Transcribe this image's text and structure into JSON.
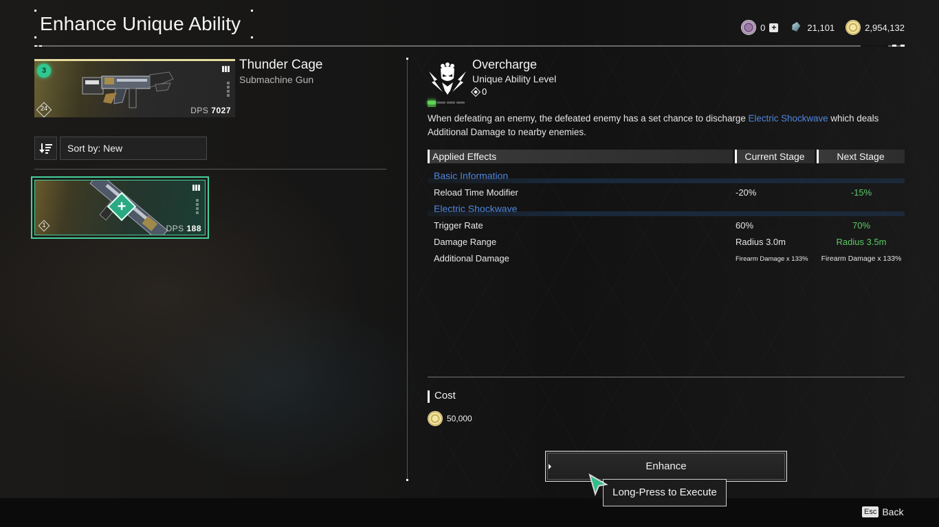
{
  "page": {
    "title": "Enhance Unique Ability"
  },
  "currencies": [
    {
      "icon": "caliber-token-icon",
      "value": "0",
      "has_add": true
    },
    {
      "icon": "crystal-icon",
      "value": "21,101"
    },
    {
      "icon": "gold-icon",
      "value": "2,954,132"
    }
  ],
  "weapon": {
    "name": "Thunder Cage",
    "type": "Submachine Gun",
    "rarity_level": "3",
    "level": "24",
    "dps_label": "DPS",
    "dps_value": "7027"
  },
  "sort": {
    "label": "Sort by: New"
  },
  "material": {
    "level": "1",
    "dps_label": "DPS",
    "dps_value": "188",
    "selected": true
  },
  "ability": {
    "name": "Overcharge",
    "subtitle": "Unique Ability Level",
    "level": "0",
    "level_progress": "1 of 4",
    "description_pre": "When defeating an enemy, the defeated enemy has a set chance to discharge ",
    "description_highlight": "Electric Shockwave",
    "description_post": " which deals Additional Damage to nearby enemies."
  },
  "effects": {
    "headers": {
      "applied": "Applied Effects",
      "current": "Current Stage",
      "next": "Next Stage"
    },
    "rows": [
      {
        "type": "section",
        "label": "Basic Information"
      },
      {
        "type": "stat",
        "label": "Reload Time Modifier",
        "current": "-20%",
        "next": "-15%",
        "changed": true
      },
      {
        "type": "section",
        "label": "Electric Shockwave"
      },
      {
        "type": "stat",
        "label": "Trigger Rate",
        "current": "60%",
        "next": "70%",
        "changed": true
      },
      {
        "type": "stat",
        "label": "Damage Range",
        "current": "Radius 3.0m",
        "next": "Radius 3.5m",
        "changed": true
      },
      {
        "type": "stat",
        "label": "Additional Damage",
        "current": "Firearm Damage x 133%",
        "next": "Firearm Damage x 133%",
        "changed": false
      }
    ]
  },
  "cost": {
    "label": "Cost",
    "amount": "50,000",
    "icon": "gold-icon"
  },
  "actions": {
    "enhance_label": "Enhance",
    "tooltip": "Long-Press to Execute",
    "back_key": "Esc",
    "back_label": "Back"
  },
  "colors": {
    "accent_green": "#45d29c",
    "next_stage_green": "#5ccc66",
    "highlight_blue": "#4f86e0"
  }
}
